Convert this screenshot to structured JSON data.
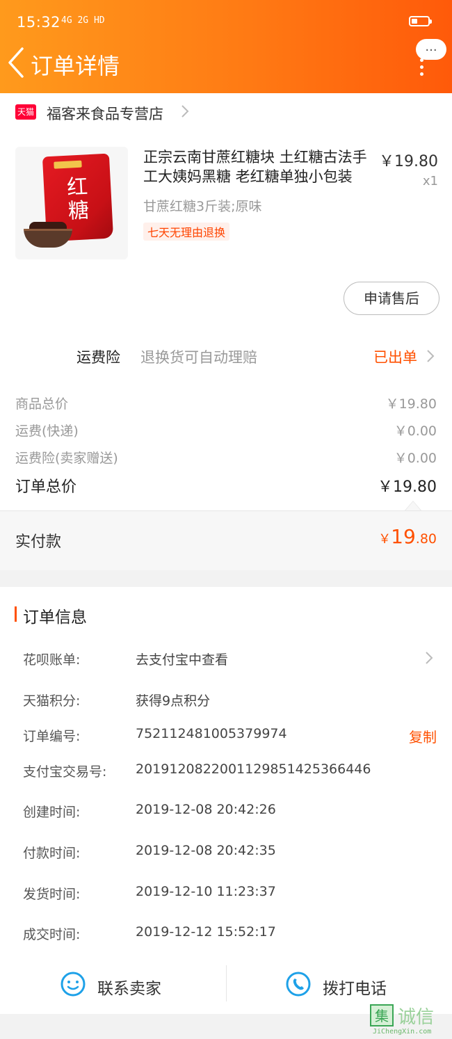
{
  "status_bar": {
    "time": "15:32",
    "signal": "4G 2G HD"
  },
  "header": {
    "title": "订单详情",
    "menu_bubble": "..."
  },
  "shop": {
    "badge": "天猫",
    "name": "福客来食品专营店"
  },
  "product": {
    "image_text": "红糖",
    "title": "正宗云南甘蔗红糖块 土红糖古法手工大姨妈黑糖 老红糖单独小包装",
    "price": "￥19.80",
    "qty": "x1",
    "spec": "甘蔗红糖3斤装;原味",
    "return_tag": "七天无理由退换",
    "after_sale_button": "申请售后"
  },
  "shipping_insurance": {
    "label": "运费险",
    "desc": "退换货可自动理赔",
    "status": "已出单"
  },
  "fees": [
    {
      "label": "商品总价",
      "value": "￥19.80"
    },
    {
      "label": "运费(快递)",
      "value": "￥0.00"
    },
    {
      "label": "运费险(卖家赠送)",
      "value": "￥0.00"
    }
  ],
  "total": {
    "label": "订单总价",
    "value": "￥19.80"
  },
  "paid": {
    "label": "实付款",
    "currency": "￥",
    "int": "19",
    "dec": ".80"
  },
  "order_info": {
    "title": "订单信息",
    "rows": [
      {
        "key": "花呗账单:",
        "value": "去支付宝中查看"
      },
      {
        "key": "天猫积分:",
        "value": "获得9点积分"
      },
      {
        "key": "订单编号:",
        "value": "752112481005379974",
        "action": "复制"
      },
      {
        "key": "支付宝交易号:",
        "value": "2019120822001129851425366446"
      },
      {
        "key": "创建时间:",
        "value": "2019-12-08 20:42:26"
      },
      {
        "key": "付款时间:",
        "value": "2019-12-08 20:42:35"
      },
      {
        "key": "发货时间:",
        "value": "2019-12-10 11:23:37"
      },
      {
        "key": "成交时间:",
        "value": "2019-12-12 15:52:17"
      }
    ]
  },
  "bottom": {
    "contact": "联系卖家",
    "call": "拨打电话"
  },
  "watermark": {
    "text": "诚信",
    "mark": "集",
    "sub": "JiChengXin.com"
  },
  "colors": {
    "accent": "#ff5000",
    "header_start": "#ff9a1c",
    "header_end": "#ff5a0a",
    "tmall_red": "#ff0036"
  }
}
